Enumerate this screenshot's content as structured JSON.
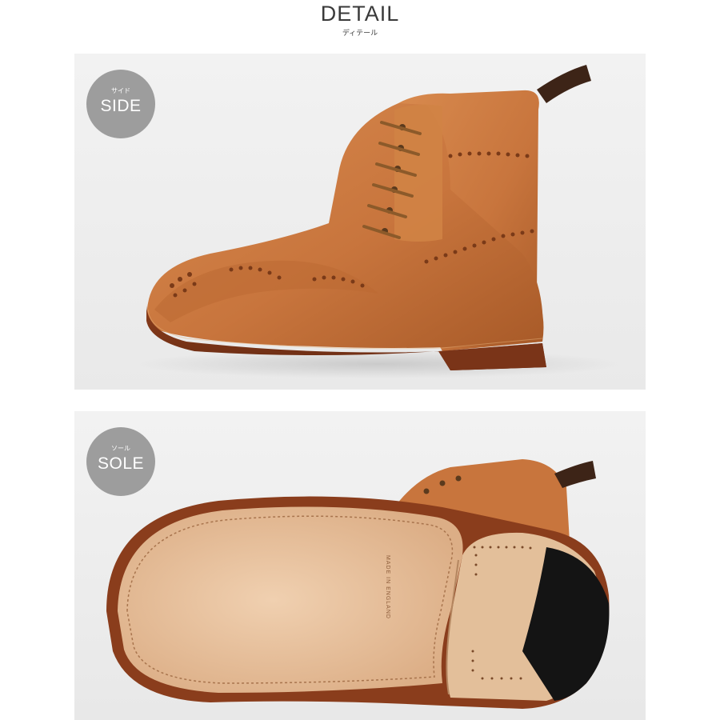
{
  "header": {
    "title": "DETAIL",
    "subtitle": "ディテール"
  },
  "panels": [
    {
      "badge_sub": "サイド",
      "badge_label": "SIDE",
      "icon": "boot-side-photo"
    },
    {
      "badge_sub": "ソール",
      "badge_label": "SOLE",
      "icon": "boot-sole-photo"
    }
  ],
  "sole_stamp": "MADE IN ENGLAND",
  "colors": {
    "leather": "#c8753d",
    "leather_dark": "#9d4f22",
    "welt": "#7a3418",
    "sole_tan": "#e7c3a0",
    "heel_rubber": "#141414",
    "badge": "#9d9d9d",
    "background": "#efefef"
  }
}
